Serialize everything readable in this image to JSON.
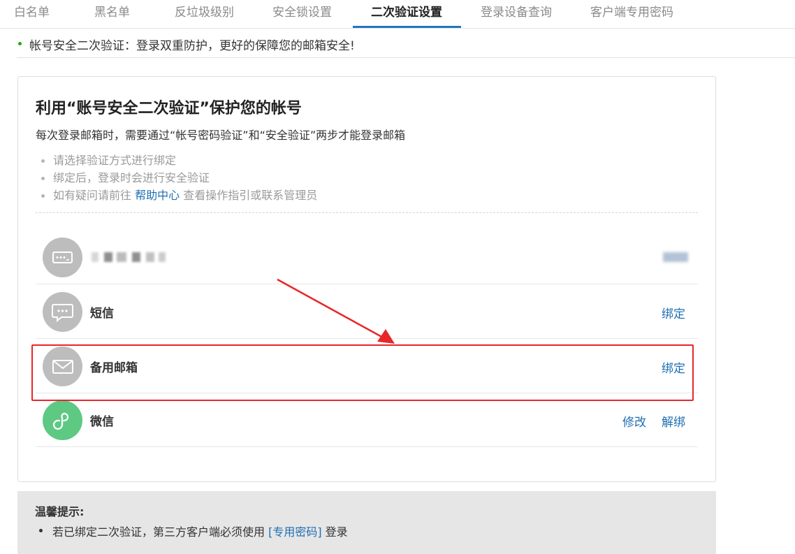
{
  "tabs": [
    {
      "label": "白名单",
      "active": false
    },
    {
      "label": "黑名单",
      "active": false
    },
    {
      "label": "反垃圾级别",
      "active": false
    },
    {
      "label": "安全锁设置",
      "active": false
    },
    {
      "label": "二次验证设置",
      "active": true
    },
    {
      "label": "登录设备查询",
      "active": false
    },
    {
      "label": "客户端专用密码",
      "active": false
    }
  ],
  "notice": {
    "text": "帐号安全二次验证：登录双重防护，更好的保障您的邮箱安全!"
  },
  "panel": {
    "title": "利用“账号安全二次验证”保护您的帐号",
    "description": "每次登录邮箱时，需要通过“帐号密码验证”和“安全验证”两步才能登录邮箱",
    "tips": [
      {
        "text": "请选择验证方式进行绑定"
      },
      {
        "text": "绑定后，登录时会进行安全验证"
      },
      {
        "text_before": "如有疑问请前往 ",
        "link": "帮助中心",
        "text_after": " 查看操作指引或联系管理员"
      }
    ]
  },
  "methods": [
    {
      "icon": "password-icon",
      "label": "",
      "actions": [],
      "masked": true
    },
    {
      "icon": "sms-icon",
      "label": "短信",
      "actions": [
        "绑定"
      ]
    },
    {
      "icon": "mail-icon",
      "label": "备用邮箱",
      "actions": [
        "绑定"
      ]
    },
    {
      "icon": "wechat-icon",
      "label": "微信",
      "actions": [
        "修改",
        "解绑"
      ]
    }
  ],
  "annotation": {
    "color": "#e8262a"
  },
  "hint": {
    "title": "温馨提示:",
    "item_before": "若已绑定二次验证，第三方客户端必须使用 ",
    "item_link": "[专用密码]",
    "item_after": " 登录"
  },
  "colors": {
    "link": "#1f6fb2",
    "active_tab_underline": "#1f78c4",
    "notice_dot": "#2aa515",
    "wechat_icon_bg": "#5dc983",
    "icon_bg": "#bdbdbd"
  }
}
